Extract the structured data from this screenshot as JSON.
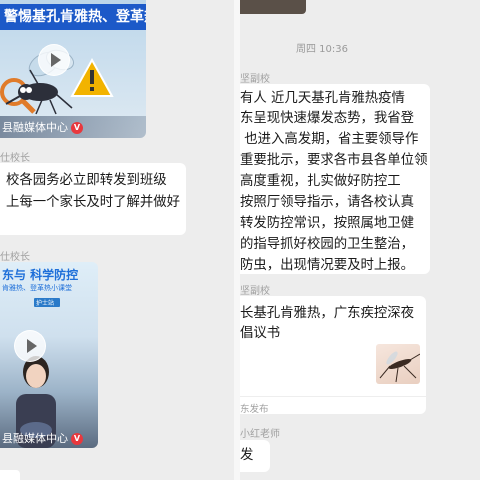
{
  "left": {
    "video1": {
      "banner": "警惕基孔肯雅热、登革热",
      "footer": "县融媒体中心"
    },
    "msg1": {
      "sender": "仕校长",
      "lines": [
        "校各园务必立即转发到班级",
        "上每一个家长及时了解并做好"
      ]
    },
    "sender2": "仕校长",
    "video2": {
      "title": "东与 科学防控",
      "subtitle": "肯雅热、登革热小课堂",
      "sign": "护士站",
      "footer": "县融媒体中心"
    }
  },
  "right": {
    "timestamp": "周四 10:36",
    "msg1": {
      "sender": "坚副校",
      "lines": [
        "有人  近几天基孔肯雅热疫情",
        "东呈现快速爆发态势，我省登",
        " 也进入高发期，省主要领导作",
        "重要批示，要求各市县各单位领",
        "高度重视，扎实做好防控工",
        "按照厅领导指示，请各校认真",
        "转发防控常识，按照属地卫健",
        "的指导抓好校园的卫生整治，",
        "防虫，出现情况要及时上报。"
      ]
    },
    "msg2": {
      "sender": "坚副校",
      "lines": [
        "长基孔肯雅热，广东疾控深夜",
        "倡议书"
      ],
      "source": "东发布"
    },
    "msg3": {
      "sender": "小红老师",
      "text": "发"
    }
  },
  "colors": {
    "background": "#ededed",
    "bubble": "#ffffff",
    "banner": "#1c59c8",
    "badge": "#e8383d"
  }
}
